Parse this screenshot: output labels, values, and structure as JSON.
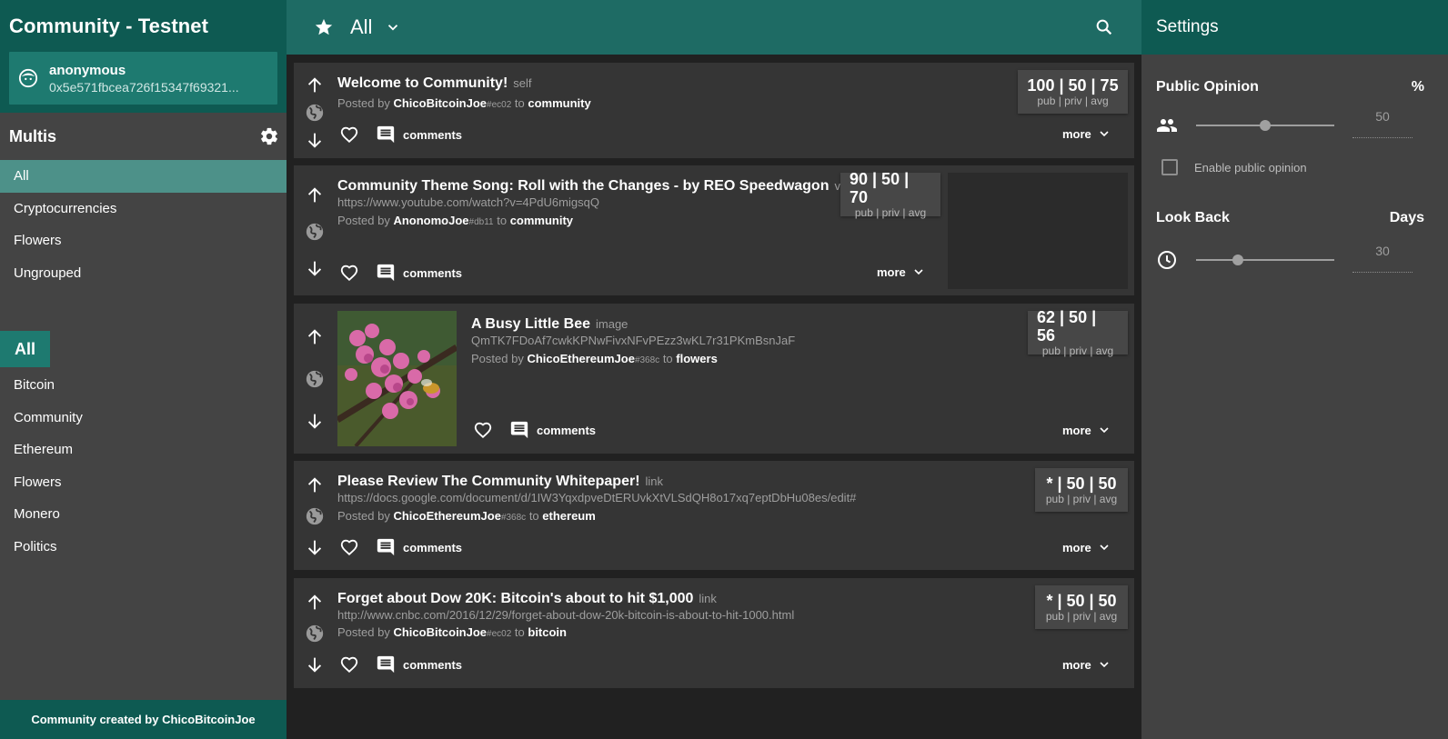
{
  "app": {
    "title": "Community - Testnet"
  },
  "user": {
    "name": "anonymous",
    "address": "0x5e571fbcea726f15347f69321..."
  },
  "multis": {
    "title": "Multis",
    "items": [
      {
        "label": "All",
        "active": true
      },
      {
        "label": "Cryptocurrencies"
      },
      {
        "label": "Flowers"
      },
      {
        "label": "Ungrouped"
      }
    ]
  },
  "topics": {
    "all_label": "All",
    "items": [
      {
        "label": "Bitcoin"
      },
      {
        "label": "Community"
      },
      {
        "label": "Ethereum"
      },
      {
        "label": "Flowers"
      },
      {
        "label": "Monero"
      },
      {
        "label": "Politics"
      }
    ]
  },
  "footer": {
    "text": "Community created by ChicoBitcoinJoe"
  },
  "topbar": {
    "title": "All"
  },
  "settings": {
    "title": "Settings",
    "public_opinion": {
      "label": "Public Opinion",
      "unit": "%",
      "value": "50",
      "level": 0.5
    },
    "enable_public_opinion": {
      "label": "Enable public opinion",
      "checked": false
    },
    "look_back": {
      "label": "Look Back",
      "unit": "Days",
      "value": "30",
      "level": 0.3
    }
  },
  "labels": {
    "comments": "comments",
    "more": "more",
    "posted_by": "Posted by",
    "to": "to",
    "score_caption": "pub | priv | avg"
  },
  "posts": [
    {
      "title": "Welcome to Community!",
      "kind": "self",
      "url": "",
      "author": "ChicoBitcoinJoe",
      "hash": "#ec02",
      "community": "community",
      "score": "100 | 50 | 75"
    },
    {
      "title": "Community Theme Song: Roll with the Changes - by REO Speedwagon",
      "kind": "video",
      "url": "https://www.youtube.com/watch?v=4PdU6migsqQ",
      "author": "AnonomoJoe",
      "hash": "#db11",
      "community": "community",
      "score": "90 | 50 | 70"
    },
    {
      "title": "A Busy Little Bee",
      "kind": "image",
      "url": "QmTK7FDoAf7cwkKPNwFivxNFvPEzz3wKL7r31PKmBsnJaF",
      "author": "ChicoEthereumJoe",
      "hash": "#368c",
      "community": "flowers",
      "score": "62 | 50 | 56"
    },
    {
      "title": "Please Review The Community Whitepaper!",
      "kind": "link",
      "url": "https://docs.google.com/document/d/1IW3YqxdpveDtERUvkXtVLSdQH8o17xq7eptDbHu08es/edit#",
      "author": "ChicoEthereumJoe",
      "hash": "#368c",
      "community": "ethereum",
      "score": "* | 50 | 50"
    },
    {
      "title": "Forget about Dow 20K: Bitcoin's about to hit $1,000",
      "kind": "link",
      "url": "http://www.cnbc.com/2016/12/29/forget-about-dow-20k-bitcoin-is-about-to-hit-1000.html",
      "author": "ChicoBitcoinJoe",
      "hash": "#ec02",
      "community": "bitcoin",
      "score": "* | 50 | 50"
    }
  ]
}
